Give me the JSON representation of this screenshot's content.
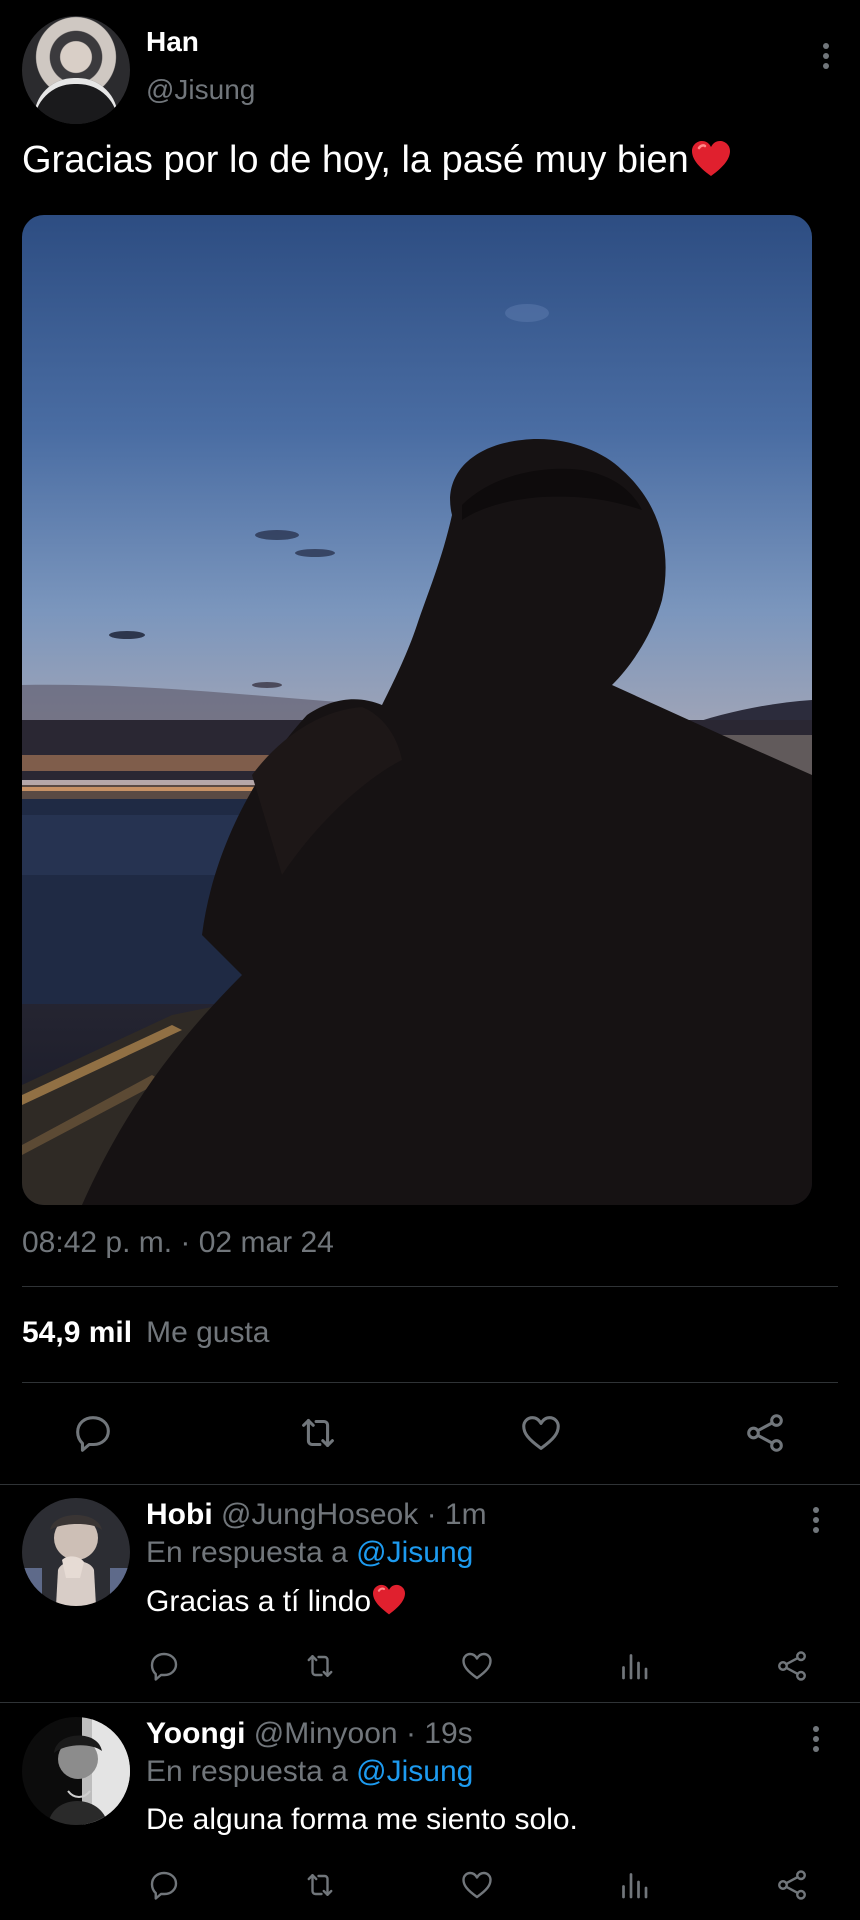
{
  "main_tweet": {
    "name": "Han",
    "handle": "@Jisung",
    "text": "Gracias por lo de hoy, la pasé muy bien",
    "emoji": "red-heart",
    "timestamp": "08:42 p. m. · 02 mar 24",
    "likes_count": "54,9 mil",
    "likes_label": "Me gusta"
  },
  "replies": [
    {
      "name": "Hobi",
      "handle": "@JungHoseok",
      "time": "· 1m",
      "reply_prefix": "En respuesta a",
      "reply_to": "@Jisung",
      "text": "Gracias a tí lindo",
      "emoji": "red-heart"
    },
    {
      "name": "Yoongi",
      "handle": "@Minyoon",
      "time": "· 19s",
      "reply_prefix": "En respuesta a",
      "reply_to": "@Jisung",
      "text": "De alguna forma me siento solo."
    }
  ],
  "icons": {
    "reply": "reply-icon",
    "retweet": "retweet-icon",
    "like": "heart-icon",
    "share": "share-icon",
    "views": "views-icon",
    "more": "more-vertical-icon"
  },
  "colors": {
    "background": "#000000",
    "text": "#ffffff",
    "secondary": "#71767b",
    "accent": "#1d9bf0",
    "divider": "#2f3336",
    "heart": "#e0202e"
  }
}
